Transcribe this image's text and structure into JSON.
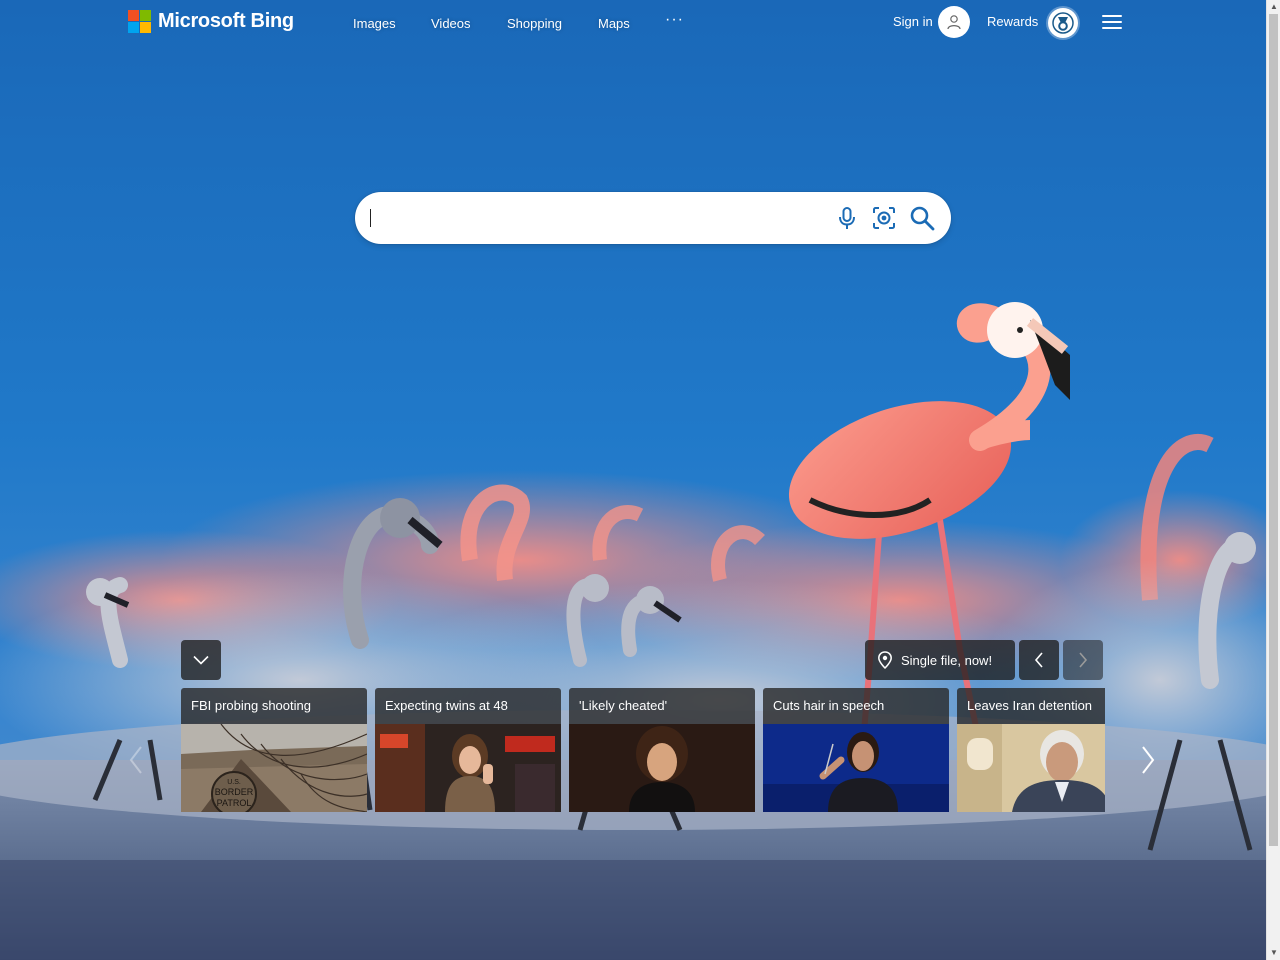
{
  "header": {
    "brand": "Microsoft Bing",
    "nav": [
      {
        "label": "Images"
      },
      {
        "label": "Videos"
      },
      {
        "label": "Shopping"
      },
      {
        "label": "Maps"
      }
    ],
    "more_label": "···",
    "signin_label": "Sign in",
    "rewards_label": "Rewards"
  },
  "search": {
    "value": "",
    "placeholder": ""
  },
  "image_of_day": {
    "title": "Single file, now!"
  },
  "news": [
    {
      "title": "FBI probing shooting"
    },
    {
      "title": "Expecting twins at 48"
    },
    {
      "title": "'Likely cheated'"
    },
    {
      "title": "Cuts hair in speech"
    },
    {
      "title": "Leaves Iran detention"
    }
  ],
  "colors": {
    "sky": "#1f73c4",
    "flamingo": "#f2847a",
    "logo_red": "#f25022",
    "logo_green": "#7fba00",
    "logo_blue": "#00a4ef",
    "logo_yellow": "#ffb900"
  }
}
